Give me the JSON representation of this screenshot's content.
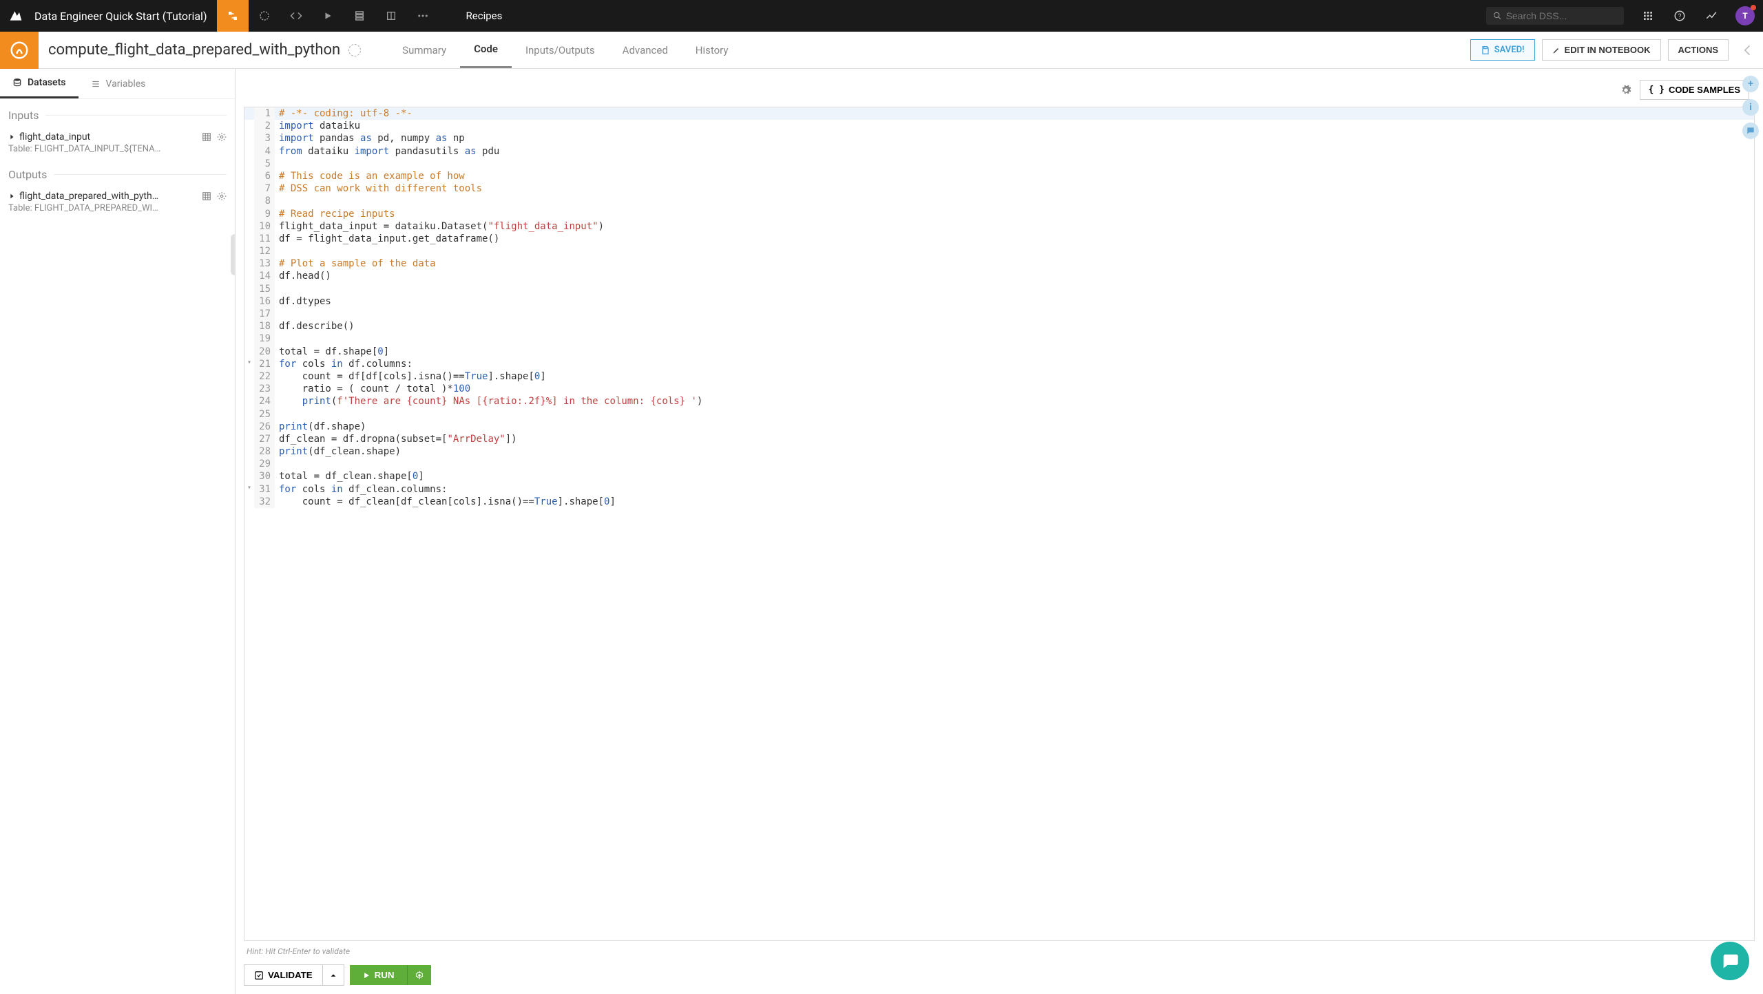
{
  "topbar": {
    "project_title": "Data Engineer Quick Start (Tutorial)",
    "breadcrumb": "Recipes",
    "search_placeholder": "Search DSS...",
    "avatar_letter": "T"
  },
  "header": {
    "recipe_name": "compute_flight_data_prepared_with_python",
    "tabs": [
      "Summary",
      "Code",
      "Inputs/Outputs",
      "Advanced",
      "History"
    ],
    "active_tab": "Code",
    "saved_label": "SAVED!",
    "edit_notebook_label": "EDIT IN NOTEBOOK",
    "actions_label": "ACTIONS"
  },
  "sidebar": {
    "tabs": {
      "datasets": "Datasets",
      "variables": "Variables"
    },
    "inputs_head": "Inputs",
    "outputs_head": "Outputs",
    "inputs": [
      {
        "name": "flight_data_input",
        "sub": "Table: FLIGHT_DATA_INPUT_${TENA…"
      }
    ],
    "outputs": [
      {
        "name": "flight_data_prepared_with_pyth…",
        "sub": "Table: FLIGHT_DATA_PREPARED_WI…"
      }
    ]
  },
  "editor": {
    "code_samples_label": "CODE SAMPLES",
    "hint": "Hint: Hit Ctrl-Enter to validate",
    "validate_label": "VALIDATE",
    "run_label": "RUN",
    "lines": [
      {
        "n": 1,
        "hl": true,
        "fold": "",
        "seg": [
          [
            "comment",
            "# -*- coding: utf-8 -*-"
          ]
        ]
      },
      {
        "n": 2,
        "fold": "",
        "seg": [
          [
            "keyword",
            "import"
          ],
          [
            "",
            " dataiku"
          ]
        ]
      },
      {
        "n": 3,
        "fold": "",
        "seg": [
          [
            "keyword",
            "import"
          ],
          [
            "",
            " pandas "
          ],
          [
            "keyword",
            "as"
          ],
          [
            "",
            " pd, numpy "
          ],
          [
            "keyword",
            "as"
          ],
          [
            "",
            " np"
          ]
        ]
      },
      {
        "n": 4,
        "fold": "",
        "seg": [
          [
            "keyword",
            "from"
          ],
          [
            "",
            " dataiku "
          ],
          [
            "keyword",
            "import"
          ],
          [
            "",
            " pandasutils "
          ],
          [
            "keyword",
            "as"
          ],
          [
            "",
            " pdu"
          ]
        ]
      },
      {
        "n": 5,
        "fold": "",
        "seg": []
      },
      {
        "n": 6,
        "fold": "",
        "seg": [
          [
            "comment",
            "# This code is an example of how"
          ]
        ]
      },
      {
        "n": 7,
        "fold": "",
        "seg": [
          [
            "comment",
            "# DSS can work with different tools"
          ]
        ]
      },
      {
        "n": 8,
        "fold": "",
        "seg": []
      },
      {
        "n": 9,
        "fold": "",
        "seg": [
          [
            "comment",
            "# Read recipe inputs"
          ]
        ]
      },
      {
        "n": 10,
        "fold": "",
        "seg": [
          [
            "",
            "flight_data_input = dataiku.Dataset("
          ],
          [
            "string",
            "\"flight_data_input\""
          ],
          [
            "",
            ")"
          ]
        ]
      },
      {
        "n": 11,
        "fold": "",
        "seg": [
          [
            "",
            "df = flight_data_input.get_dataframe()"
          ]
        ]
      },
      {
        "n": 12,
        "fold": "",
        "seg": []
      },
      {
        "n": 13,
        "fold": "",
        "seg": [
          [
            "comment",
            "# Plot a sample of the data"
          ]
        ]
      },
      {
        "n": 14,
        "fold": "",
        "seg": [
          [
            "",
            "df.head()"
          ]
        ]
      },
      {
        "n": 15,
        "fold": "",
        "seg": []
      },
      {
        "n": 16,
        "fold": "",
        "seg": [
          [
            "",
            "df.dtypes"
          ]
        ]
      },
      {
        "n": 17,
        "fold": "",
        "seg": []
      },
      {
        "n": 18,
        "fold": "",
        "seg": [
          [
            "",
            "df.describe()"
          ]
        ]
      },
      {
        "n": 19,
        "fold": "",
        "seg": []
      },
      {
        "n": 20,
        "fold": "",
        "seg": [
          [
            "",
            "total = df.shape["
          ],
          [
            "number",
            "0"
          ],
          [
            "",
            "]"
          ]
        ]
      },
      {
        "n": 21,
        "fold": "▾",
        "seg": [
          [
            "keyword",
            "for"
          ],
          [
            "",
            " cols "
          ],
          [
            "keyword",
            "in"
          ],
          [
            "",
            " df.columns:"
          ]
        ]
      },
      {
        "n": 22,
        "fold": "",
        "seg": [
          [
            "",
            "    count = df[df[cols].isna()=="
          ],
          [
            "keyword",
            "True"
          ],
          [
            "",
            "].shape["
          ],
          [
            "number",
            "0"
          ],
          [
            "",
            "]"
          ]
        ]
      },
      {
        "n": 23,
        "fold": "",
        "seg": [
          [
            "",
            "    ratio = ( count / total )*"
          ],
          [
            "number",
            "100"
          ]
        ]
      },
      {
        "n": 24,
        "fold": "",
        "seg": [
          [
            "",
            "    "
          ],
          [
            "builtin",
            "print"
          ],
          [
            "",
            "("
          ],
          [
            "string",
            "f'There are {count} NAs [{ratio:.2f}%] in the column: {cols} '"
          ],
          [
            "",
            ")"
          ]
        ]
      },
      {
        "n": 25,
        "fold": "",
        "seg": []
      },
      {
        "n": 26,
        "fold": "",
        "seg": [
          [
            "builtin",
            "print"
          ],
          [
            "",
            "(df.shape)"
          ]
        ]
      },
      {
        "n": 27,
        "fold": "",
        "seg": [
          [
            "",
            "df_clean = df.dropna(subset=["
          ],
          [
            "string",
            "\"ArrDelay\""
          ],
          [
            "",
            "])"
          ]
        ]
      },
      {
        "n": 28,
        "fold": "",
        "seg": [
          [
            "builtin",
            "print"
          ],
          [
            "",
            "(df_clean.shape)"
          ]
        ]
      },
      {
        "n": 29,
        "fold": "",
        "seg": []
      },
      {
        "n": 30,
        "fold": "",
        "seg": [
          [
            "",
            "total = df_clean.shape["
          ],
          [
            "number",
            "0"
          ],
          [
            "",
            "]"
          ]
        ]
      },
      {
        "n": 31,
        "fold": "▾",
        "seg": [
          [
            "keyword",
            "for"
          ],
          [
            "",
            " cols "
          ],
          [
            "keyword",
            "in"
          ],
          [
            "",
            " df_clean.columns:"
          ]
        ]
      },
      {
        "n": 32,
        "fold": "",
        "seg": [
          [
            "",
            "    count = df_clean[df_clean[cols].isna()=="
          ],
          [
            "keyword",
            "True"
          ],
          [
            "",
            "].shape["
          ],
          [
            "number",
            "0"
          ],
          [
            "",
            "]"
          ]
        ]
      }
    ]
  }
}
